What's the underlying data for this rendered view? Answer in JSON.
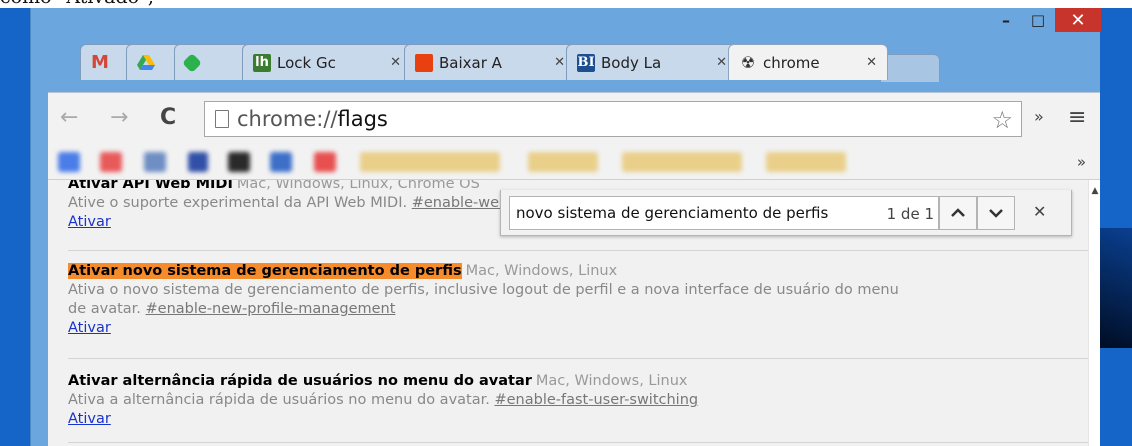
{
  "article_text": "como \"Ativado\";",
  "window": {
    "min_label": "–",
    "max_label": "□",
    "close_label": "✕"
  },
  "tabs": [
    {
      "icon": "gmail-icon",
      "label": "",
      "close": ""
    },
    {
      "icon": "drive-icon",
      "label": "",
      "close": ""
    },
    {
      "icon": "feedly-icon",
      "label": "",
      "close": ""
    },
    {
      "icon": "lh-icon",
      "icon_text": "lh",
      "label": "Lock Gc",
      "close": "✕"
    },
    {
      "icon": "office-icon",
      "icon_text": "",
      "label": "Baixar A",
      "close": "✕"
    },
    {
      "icon": "bl-icon",
      "icon_text": "BI",
      "label": "Body La",
      "close": "✕"
    },
    {
      "icon": "radiation-icon",
      "icon_text": "☢",
      "label": "chrome",
      "close": "✕"
    }
  ],
  "toolbar": {
    "back": "←",
    "forward": "→",
    "reload": "C",
    "url_prefix": "chrome://",
    "url_path": "flags",
    "star": "☆",
    "extensions": "»",
    "menu": "≡"
  },
  "bookmarks": {
    "more": "»"
  },
  "flags": [
    {
      "title": "Ativar API Web MIDI",
      "platforms": "Mac, Windows, Linux, Chrome OS",
      "description": "Ative o suporte experimental da API Web MIDI.",
      "hash": "#enable-web-midi",
      "link": "Ativar"
    },
    {
      "title": "Ativar novo sistema de gerenciamento de perfis",
      "platforms": "Mac, Windows, Linux",
      "description": "Ativa o novo sistema de gerenciamento de perfis, inclusive logout de perfil e a nova interface de usuário do menu",
      "description2": "de avatar.",
      "hash": "#enable-new-profile-management",
      "link": "Ativar"
    },
    {
      "title": "Ativar alternância rápida de usuários no menu do avatar",
      "platforms": "Mac, Windows, Linux",
      "description": "Ativa a alternância rápida de usuários no menu do avatar.",
      "hash": "#enable-fast-user-switching",
      "link": "Ativar"
    }
  ],
  "findbar": {
    "query": "novo sistema de gerenciamento de perfis",
    "count": "1 de 1",
    "prev": "︿",
    "next": "﹀",
    "close": "✕"
  },
  "colors": {
    "highlight": "#f58b2a",
    "link": "#1a33cc",
    "frame": "#6ba6de"
  }
}
